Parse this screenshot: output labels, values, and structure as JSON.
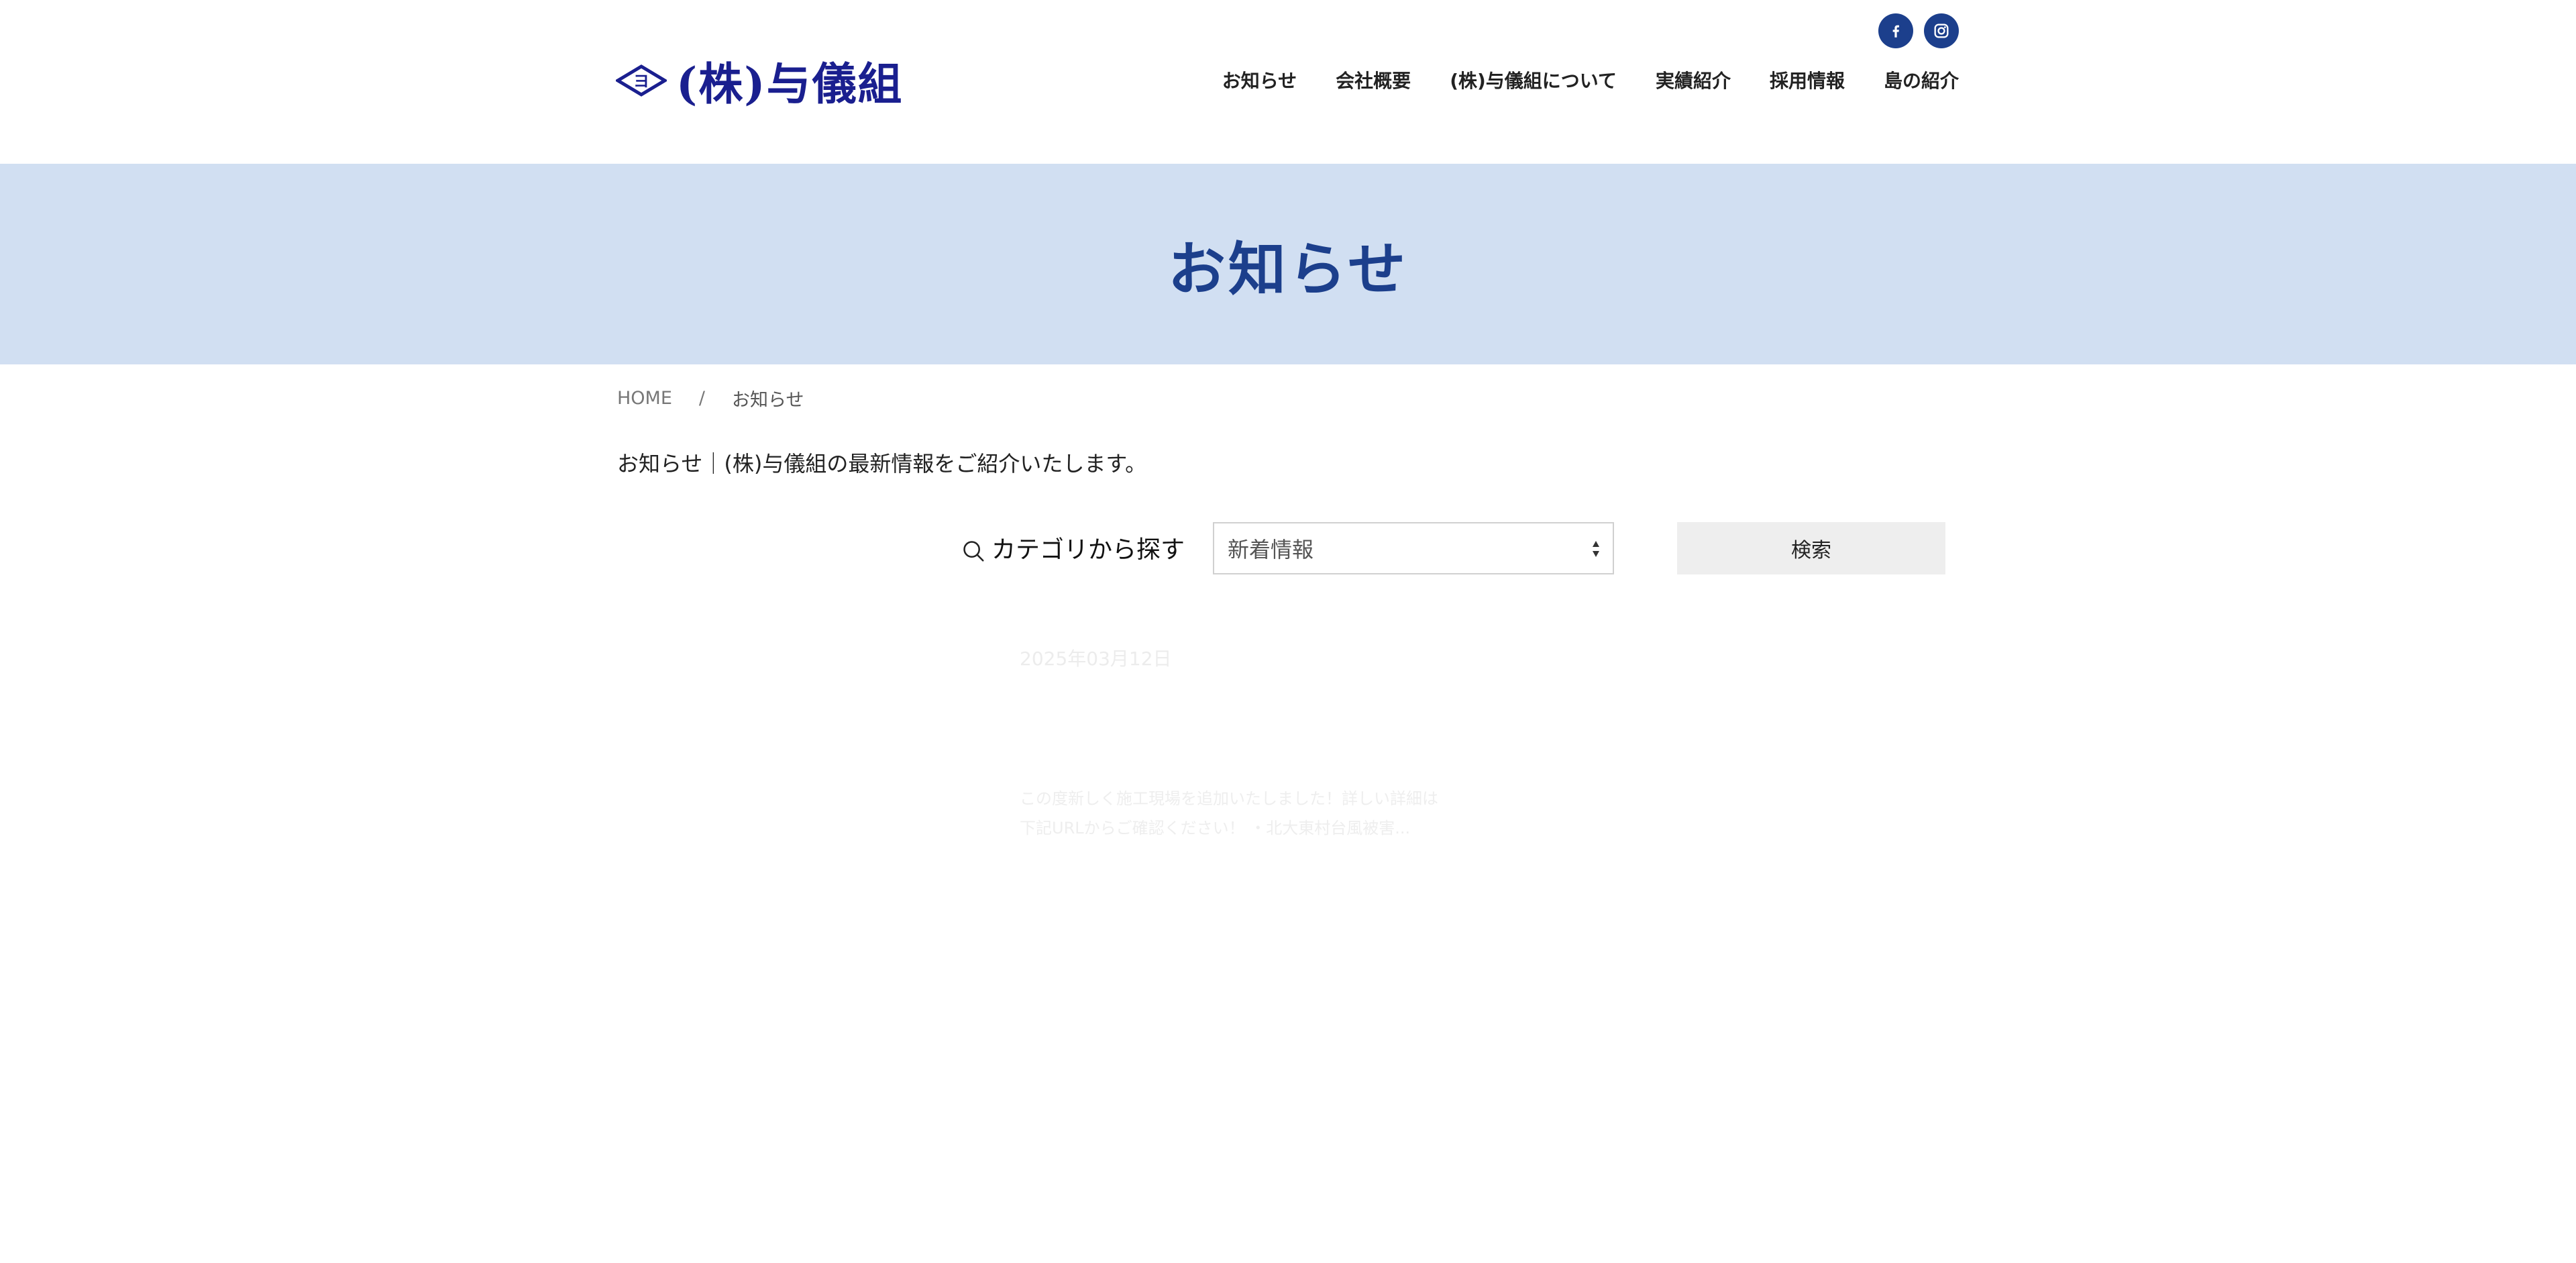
{
  "header": {
    "logo_text": "(株)与儀組",
    "logo_mark_letter": "ヨ",
    "social": [
      {
        "name": "facebook",
        "icon": "facebook-icon",
        "color": "#1c3f8c"
      },
      {
        "name": "instagram",
        "icon": "instagram-icon",
        "color": "#1c3f8c"
      }
    ],
    "nav": [
      "お知らせ",
      "会社概要",
      "(株)与儀組について",
      "実績紹介",
      "採用情報",
      "島の紹介"
    ]
  },
  "banner": {
    "title": "お知らせ",
    "background": "#d1dff2",
    "title_color": "#1c3f8c"
  },
  "breadcrumb": {
    "home": "HOME",
    "separator": "/",
    "current": "お知らせ"
  },
  "intro": "お知らせ｜(株)与儀組の最新情報をご紹介いたします。",
  "search": {
    "label": "カテゴリから探す",
    "icon": "search-icon",
    "selected_category": "新着情報",
    "button_label": "検索"
  },
  "posts": [
    {
      "date": "2025年03月12日",
      "excerpt_line1": "この度新しく施工現場を追加いたしました！詳しい詳細は",
      "excerpt_line2": "下記URLからご確認ください！ ・北大東村台風被害..."
    }
  ]
}
